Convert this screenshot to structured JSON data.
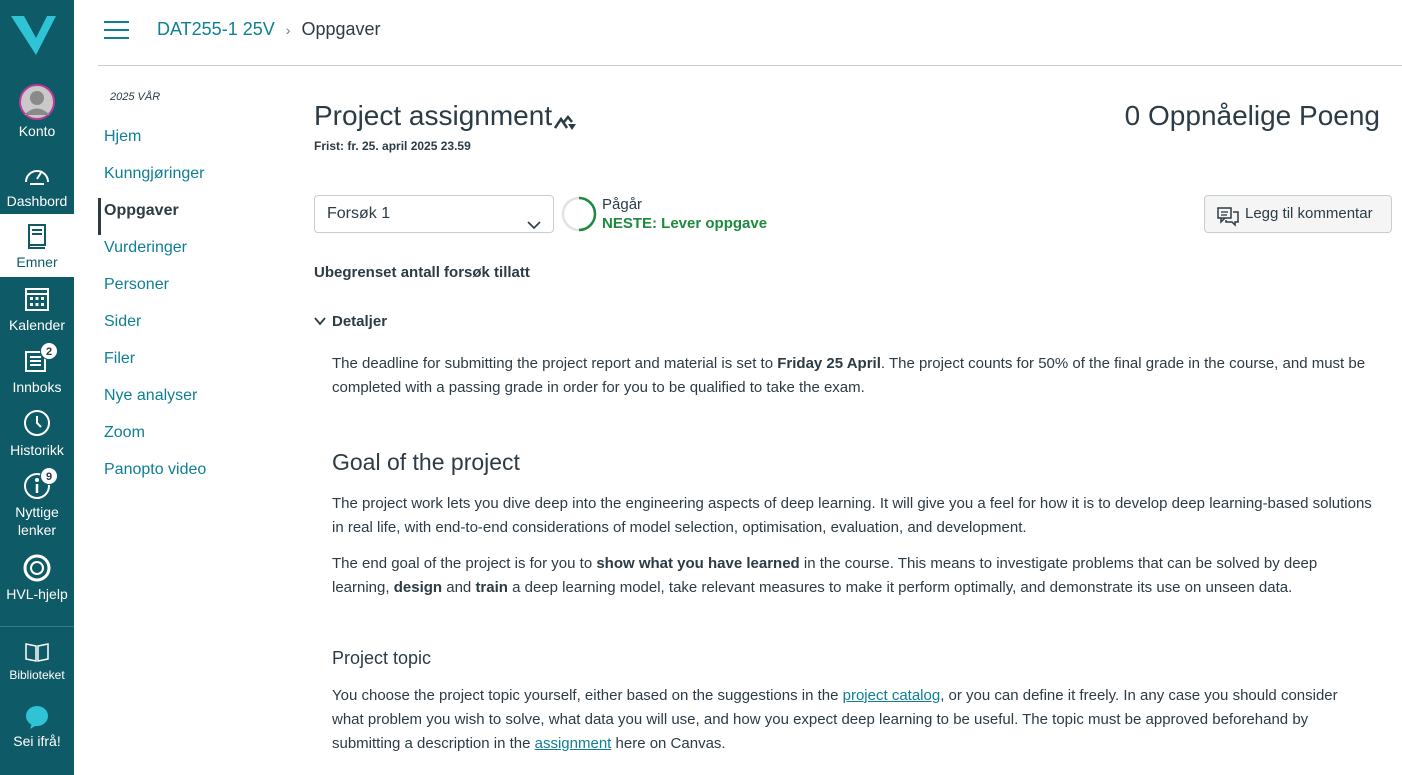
{
  "global_nav": {
    "account": "Konto",
    "dashboard": "Dashbord",
    "courses": "Emner",
    "calendar": "Kalender",
    "inbox": "Innboks",
    "inbox_badge": "2",
    "history": "Historikk",
    "links_line1": "Nyttige",
    "links_line2": "lenker",
    "links_badge": "9",
    "help": "HVL-hjelp",
    "library": "Biblioteket",
    "speakup": "Sei ifrå!",
    "brand_color": "#0e5a66"
  },
  "breadcrumb": {
    "course": "DAT255-1 25V",
    "separator": "›",
    "current": "Oppgaver"
  },
  "course_nav": {
    "term": "2025 VÅR",
    "items": [
      "Hjem",
      "Kunngjøringer",
      "Oppgaver",
      "Vurderinger",
      "Personer",
      "Sider",
      "Filer",
      "Nye analyser",
      "Zoom",
      "Panopto video"
    ],
    "active": "Oppgaver"
  },
  "assignment": {
    "title": "Project assignment",
    "deadline": "Frist: fr. 25. april 2025 23.59",
    "points": "0 Oppnåelige Poeng",
    "attempt": "Forsøk 1",
    "status": "Pågår",
    "next_step": "NESTE: Lever oppgave",
    "comment_button": "Legg til kommentar",
    "unlimited": "Ubegrenset antall forsøk tillatt",
    "details_label": "Detaljer"
  },
  "content": {
    "p1_a": "The deadline for submitting the project report and material is set to ",
    "p1_b": "Friday 25 April",
    "p1_c": ". The project counts for 50% of the final grade in the course, and must be completed with a passing grade in order for you to be qualified to take the exam.",
    "h_goal": "Goal of the project",
    "p2": "The project work lets you dive deep into the engineering aspects of deep learning. It will give you a feel for how it is to develop deep learning-based solutions in real life, with end-to-end considerations of model selection, optimisation, evaluation, and development.",
    "p3_a": "The end goal of the project is for you to ",
    "p3_b": "show what you have learned",
    "p3_c": " in the course. This means to investigate problems that can be solved by deep learning, ",
    "p3_d": "design",
    "p3_e": " and ",
    "p3_f": "train",
    "p3_g": " a deep learning model, take relevant measures to make it perform optimally, and demonstrate its use on unseen data.",
    "h_topic": "Project topic",
    "p4_a": "You choose the project topic yourself, either based on the suggestions in the ",
    "p4_link1": "project catalog",
    "p4_b": ", or you can define it freely. In any case you should consider what problem you wish to solve, what data you will use, and how you expect deep learning to be useful. The topic must be approved beforehand by submitting a description in the ",
    "p4_link2": "assignment",
    "p4_c": " here on Canvas."
  }
}
